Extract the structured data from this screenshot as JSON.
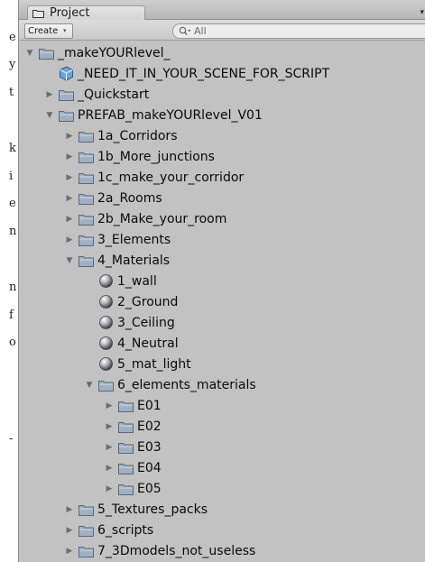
{
  "left_text": [
    "e",
    "y",
    "t",
    "k",
    "i",
    "e",
    "n",
    "n",
    "f",
    "o",
    "-"
  ],
  "tab": {
    "label": "Project",
    "corner_glyph": "▾"
  },
  "toolbar": {
    "create_label": "Create",
    "create_caret": "▾",
    "search_placeholder": "All"
  },
  "tree": [
    {
      "label": "_makeYOURlevel_",
      "depth": 0,
      "type": "folder",
      "state": "expanded"
    },
    {
      "label": "_NEED_IT_IN_YOUR_SCENE_FOR_SCRIPT",
      "depth": 1,
      "type": "prefab",
      "state": "leaf"
    },
    {
      "label": "_Quickstart",
      "depth": 1,
      "type": "folder",
      "state": "collapsed"
    },
    {
      "label": "PREFAB_makeYOURlevel_V01",
      "depth": 1,
      "type": "folder",
      "state": "expanded"
    },
    {
      "label": "1a_Corridors",
      "depth": 2,
      "type": "folder",
      "state": "collapsed"
    },
    {
      "label": "1b_More_junctions",
      "depth": 2,
      "type": "folder",
      "state": "collapsed"
    },
    {
      "label": "1c_make_your_corridor",
      "depth": 2,
      "type": "folder",
      "state": "collapsed"
    },
    {
      "label": "2a_Rooms",
      "depth": 2,
      "type": "folder",
      "state": "collapsed"
    },
    {
      "label": "2b_Make_your_room",
      "depth": 2,
      "type": "folder",
      "state": "collapsed"
    },
    {
      "label": "3_Elements",
      "depth": 2,
      "type": "folder",
      "state": "collapsed"
    },
    {
      "label": "4_Materials",
      "depth": 2,
      "type": "folder",
      "state": "expanded"
    },
    {
      "label": "1_wall",
      "depth": 3,
      "type": "material",
      "state": "leaf"
    },
    {
      "label": "2_Ground",
      "depth": 3,
      "type": "material",
      "state": "leaf"
    },
    {
      "label": "3_Ceiling",
      "depth": 3,
      "type": "material",
      "state": "leaf"
    },
    {
      "label": "4_Neutral",
      "depth": 3,
      "type": "material",
      "state": "leaf"
    },
    {
      "label": "5_mat_light",
      "depth": 3,
      "type": "material",
      "state": "leaf"
    },
    {
      "label": "6_elements_materials",
      "depth": 3,
      "type": "folder",
      "state": "expanded"
    },
    {
      "label": "E01",
      "depth": 4,
      "type": "folder",
      "state": "collapsed"
    },
    {
      "label": "E02",
      "depth": 4,
      "type": "folder",
      "state": "collapsed"
    },
    {
      "label": "E03",
      "depth": 4,
      "type": "folder",
      "state": "collapsed"
    },
    {
      "label": "E04",
      "depth": 4,
      "type": "folder",
      "state": "collapsed"
    },
    {
      "label": "E05",
      "depth": 4,
      "type": "folder",
      "state": "collapsed"
    },
    {
      "label": "5_Textures_packs",
      "depth": 2,
      "type": "folder",
      "state": "collapsed"
    },
    {
      "label": "6_scripts",
      "depth": 2,
      "type": "folder",
      "state": "collapsed"
    },
    {
      "label": "7_3Dmodels_not_useless",
      "depth": 2,
      "type": "folder",
      "state": "collapsed"
    }
  ],
  "colors": {
    "panel_bg": "#c2c2c2",
    "folder_fill": "#9fb0c2",
    "folder_tab": "#b7c5d4",
    "folder_stroke": "#586978",
    "prefab_blue": "#6fa3d8",
    "material_sphere": "#8a8f96"
  }
}
